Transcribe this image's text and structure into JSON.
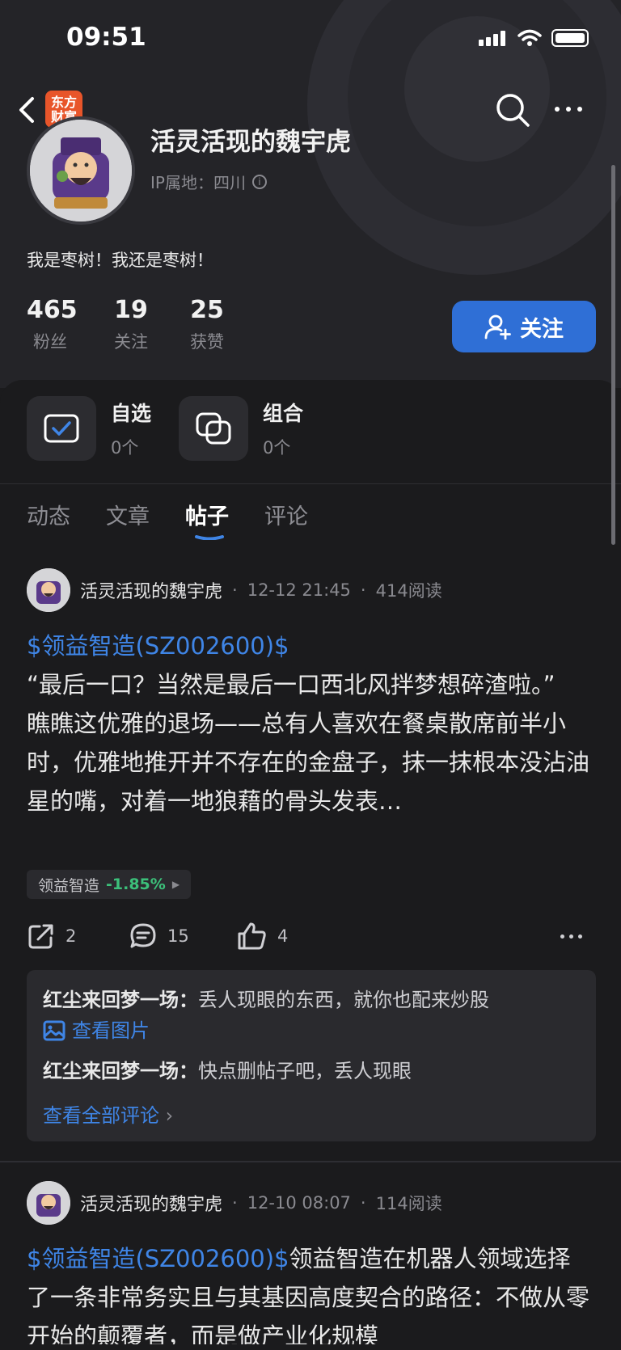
{
  "status": {
    "time": "09:51"
  },
  "header": {
    "logo_text_line1": "东方",
    "logo_text_line2": "财富",
    "username": "活灵活现的魏宇虎",
    "ip_location": "IP属地：四川",
    "bio": "我是枣树！我还是枣树！",
    "follow_label": "关注"
  },
  "stats": [
    {
      "value": "465",
      "label": "粉丝"
    },
    {
      "value": "19",
      "label": "关注"
    },
    {
      "value": "25",
      "label": "获赞"
    }
  ],
  "quick": [
    {
      "title": "自选",
      "count": "0个"
    },
    {
      "title": "组合",
      "count": "0个"
    }
  ],
  "tabs": [
    {
      "label": "动态",
      "active": false
    },
    {
      "label": "文章",
      "active": false
    },
    {
      "label": "帖子",
      "active": true
    },
    {
      "label": "评论",
      "active": false
    }
  ],
  "posts": [
    {
      "author": "活灵活现的魏宇虎",
      "date": "12-12 21:45",
      "reads": "414阅读",
      "stock_link": "$领益智造(SZ002600)$",
      "text": "“最后一口？当然是最后一口西北风拌梦想碎渣啦。”",
      "text2": "瞧瞧这优雅的退场——总有人喜欢在餐桌散席前半小时，优雅地推开并不存在的金盘子，抹一抹根本没沾油星的嘴，对着一地狼藉的骨头发表…",
      "stock_tag_name": "领益智造",
      "stock_tag_pct": "-1.85%",
      "shares": "2",
      "comments": "15",
      "likes": "4",
      "comment_list": [
        {
          "user": "红尘来回梦一场：",
          "text": "丢人现眼的东西，就你也配来炒股"
        },
        {
          "user": "红尘来回梦一场：",
          "text": "快点删帖子吧，丢人现眼"
        }
      ],
      "view_image": "查看图片",
      "view_all": "查看全部评论"
    },
    {
      "author": "活灵活现的魏宇虎",
      "date": "12-10 08:07",
      "reads": "114阅读",
      "stock_link": "$领益智造(SZ002600)$",
      "text": "领益智造在机器人领域选择了一条非常务实且与其基因高度契合的路径：不做从零开始的颠覆者，而是做产业化规模"
    }
  ],
  "colors": {
    "accent": "#2f6fd6",
    "link": "#3f85e6",
    "positive": "#3cc07a",
    "logo": "#e8552a"
  }
}
